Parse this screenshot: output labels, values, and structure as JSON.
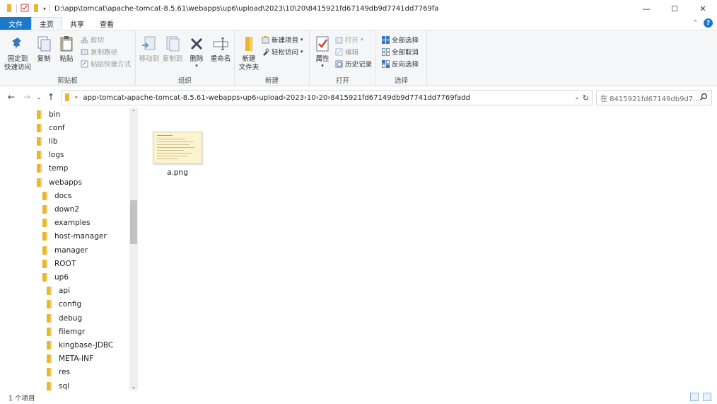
{
  "titlebar": {
    "path": "D:\\app\\tomcat\\apache-tomcat-8.5.61\\webapps\\up6\\upload\\2023\\10\\20\\8415921fd67149db9d7741dd7769fa",
    "minimize": "—",
    "maximize": "☐",
    "close": "✕"
  },
  "tabs": {
    "file": "文件",
    "home": "主页",
    "share": "共享",
    "view": "查看"
  },
  "ribbon": {
    "clipboard": {
      "label": "剪贴板",
      "pin": "固定到\n快速访问",
      "pin_l1": "固定到",
      "pin_l2": "快速访问",
      "copy": "复制",
      "paste": "粘贴",
      "cut": "剪切",
      "copy_path": "复制路径",
      "paste_shortcut": "粘贴快捷方式"
    },
    "organize": {
      "label": "组织",
      "move_to": "移动到",
      "copy_to": "复制到",
      "delete": "删除",
      "rename": "重命名"
    },
    "new": {
      "label": "新建",
      "new_folder_l1": "新建",
      "new_folder_l2": "文件夹",
      "new_item": "新建项目",
      "easy_access": "轻松访问"
    },
    "open": {
      "label": "打开",
      "properties": "属性",
      "open": "打开",
      "edit": "编辑",
      "history": "历史记录"
    },
    "select": {
      "label": "选择",
      "select_all": "全部选择",
      "select_none": "全部取消",
      "invert": "反向选择"
    }
  },
  "address": {
    "crumbs": [
      "app",
      "tomcat",
      "apache-tomcat-8.5.61",
      "webapps",
      "up6",
      "upload",
      "2023",
      "10",
      "20",
      "8415921fd67149db9d7741dd7769fadd"
    ]
  },
  "search": {
    "placeholder": "在 8415921fd67149db9d7..."
  },
  "tree": {
    "items": [
      {
        "label": "bin",
        "level": 0
      },
      {
        "label": "conf",
        "level": 0
      },
      {
        "label": "lib",
        "level": 0
      },
      {
        "label": "logs",
        "level": 0
      },
      {
        "label": "temp",
        "level": 0
      },
      {
        "label": "webapps",
        "level": 0
      },
      {
        "label": "docs",
        "level": 1
      },
      {
        "label": "down2",
        "level": 1
      },
      {
        "label": "examples",
        "level": 1
      },
      {
        "label": "host-manager",
        "level": 1
      },
      {
        "label": "manager",
        "level": 1
      },
      {
        "label": "ROOT",
        "level": 1
      },
      {
        "label": "up6",
        "level": 1
      },
      {
        "label": "api",
        "level": 2
      },
      {
        "label": "config",
        "level": 2
      },
      {
        "label": "debug",
        "level": 2
      },
      {
        "label": "filemgr",
        "level": 2
      },
      {
        "label": "kingbase-JDBC",
        "level": 2
      },
      {
        "label": "META-INF",
        "level": 2
      },
      {
        "label": "res",
        "level": 2
      },
      {
        "label": "sql",
        "level": 2
      }
    ]
  },
  "content": {
    "files": [
      {
        "name": "a.png",
        "icon": "png-thumbnail"
      }
    ]
  },
  "status": {
    "count": "1 个项目"
  },
  "colors": {
    "accent": "#1979ca",
    "folder": "#eab531"
  }
}
